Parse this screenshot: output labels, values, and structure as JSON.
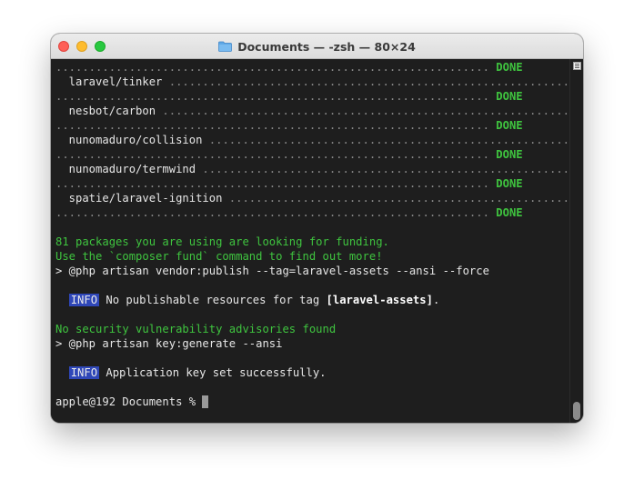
{
  "window": {
    "title": "Documents — -zsh — 80×24",
    "title_icon": "folder-icon"
  },
  "terminal": {
    "rows": [
      {
        "kind": "dots_done",
        "dots": ".................................................................",
        "status": "DONE"
      },
      {
        "kind": "pkg",
        "name": "  laravel/tinker",
        "dots": " ..............................................................."
      },
      {
        "kind": "dots_done",
        "dots": ".................................................................",
        "status": "DONE"
      },
      {
        "kind": "pkg",
        "name": "  nesbot/carbon",
        "dots": " ................................................................"
      },
      {
        "kind": "dots_done",
        "dots": ".................................................................",
        "status": "DONE"
      },
      {
        "kind": "pkg",
        "name": "  nunomaduro/collision",
        "dots": " ........................................................."
      },
      {
        "kind": "dots_done",
        "dots": ".................................................................",
        "status": "DONE"
      },
      {
        "kind": "pkg",
        "name": "  nunomaduro/termwind",
        "dots": " .........................................................."
      },
      {
        "kind": "dots_done",
        "dots": ".................................................................",
        "status": "DONE"
      },
      {
        "kind": "pkg",
        "name": "  spatie/laravel-ignition",
        "dots": " ......................................................"
      },
      {
        "kind": "dots_done",
        "dots": ".................................................................",
        "status": "DONE"
      },
      {
        "kind": "blank"
      },
      {
        "kind": "green",
        "text": "81 packages you are using are looking for funding."
      },
      {
        "kind": "green",
        "text": "Use the `composer fund` command to find out more!"
      },
      {
        "kind": "plain",
        "text": "> @php artisan vendor:publish --tag=laravel-assets --ansi --force"
      },
      {
        "kind": "blank"
      },
      {
        "kind": "info",
        "badge": "INFO",
        "text": " No publishable resources for tag ",
        "bold": "[laravel-assets]",
        "after": "."
      },
      {
        "kind": "blank"
      },
      {
        "kind": "green",
        "text": "No security vulnerability advisories found"
      },
      {
        "kind": "plain",
        "text": "> @php artisan key:generate --ansi"
      },
      {
        "kind": "blank"
      },
      {
        "kind": "info",
        "badge": "INFO",
        "text": " Application key set successfully.",
        "bold": "",
        "after": ""
      },
      {
        "kind": "blank"
      },
      {
        "kind": "prompt",
        "text": "apple@192 Documents % "
      }
    ]
  },
  "colors": {
    "terminal_bg": "#1e1e1e",
    "green": "#3fc43f",
    "info_badge": "#2f47b8"
  }
}
